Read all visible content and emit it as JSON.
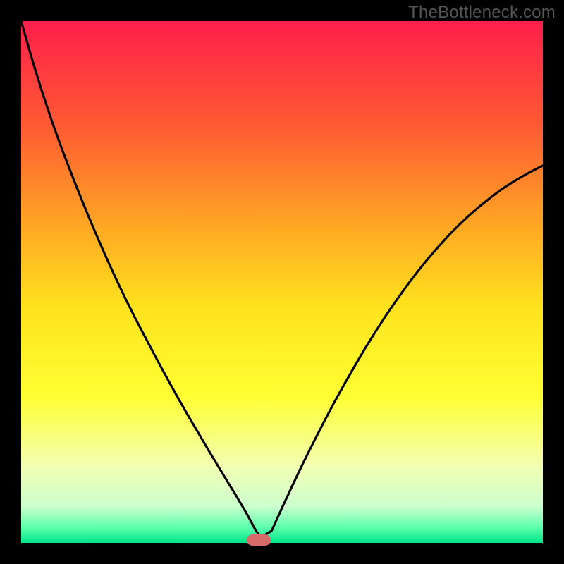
{
  "watermark": "TheBottleneck.com",
  "chart_data": {
    "type": "line",
    "title": "",
    "xlabel": "",
    "ylabel": "",
    "xlim": [
      0,
      100
    ],
    "ylim": [
      0,
      100
    ],
    "grid": false,
    "background_gradient_stops": [
      {
        "offset": 0,
        "color": "#ff1f4b"
      },
      {
        "offset": 20,
        "color": "#ff5a33"
      },
      {
        "offset": 40,
        "color": "#ffaa23"
      },
      {
        "offset": 55,
        "color": "#ffe31e"
      },
      {
        "offset": 72,
        "color": "#ffff33"
      },
      {
        "offset": 85,
        "color": "#f3ffb0"
      },
      {
        "offset": 93,
        "color": "#cdffcf"
      },
      {
        "offset": 97,
        "color": "#5dffad"
      },
      {
        "offset": 100,
        "color": "#00e58a"
      }
    ],
    "series": [
      {
        "name": "curve",
        "color": "#000000",
        "x": [
          0,
          2,
          4,
          6,
          8,
          10,
          12,
          14,
          16,
          18,
          20,
          22,
          24,
          26,
          28,
          30,
          32,
          34,
          36,
          38,
          40,
          41,
          42,
          43,
          44,
          45,
          46,
          48,
          50,
          52,
          54,
          56,
          58,
          60,
          62,
          64,
          66,
          68,
          70,
          72,
          74,
          76,
          78,
          80,
          82,
          84,
          86,
          88,
          90,
          92,
          94,
          96,
          98,
          100
        ],
        "y": [
          100,
          93,
          86.5,
          80.5,
          75,
          69.8,
          64.8,
          60,
          55.4,
          51,
          46.8,
          42.8,
          39,
          35.2,
          31.5,
          27.9,
          24.4,
          21,
          17.6,
          14.3,
          11,
          9.4,
          7.7,
          6,
          4.2,
          2.3,
          1.1,
          2.3,
          6.7,
          11,
          15.2,
          19.2,
          23.1,
          26.9,
          30.5,
          34,
          37.4,
          40.6,
          43.7,
          46.6,
          49.4,
          52,
          54.5,
          56.8,
          59,
          61,
          62.9,
          64.6,
          66.2,
          67.7,
          69,
          70.2,
          71.3,
          72.3
        ]
      }
    ],
    "marker": {
      "x": 45.5,
      "y": 0.5,
      "color": "#d86a6a"
    }
  }
}
